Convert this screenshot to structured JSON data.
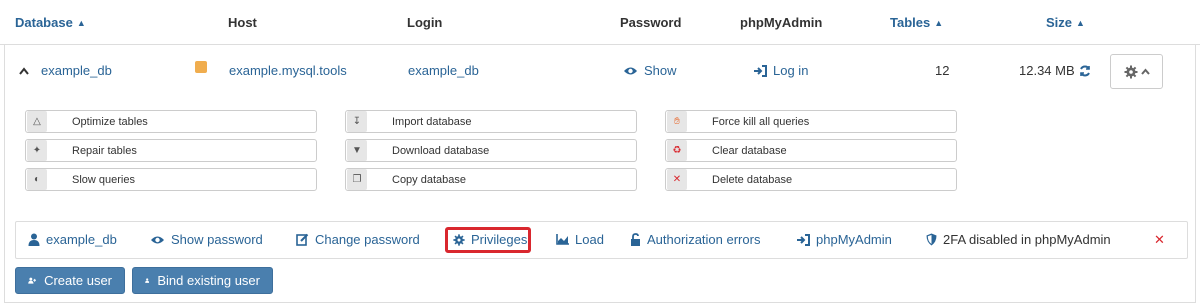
{
  "header": {
    "database": "Database",
    "host": "Host",
    "login": "Login",
    "password": "Password",
    "phpmyadmin": "phpMyAdmin",
    "tables": "Tables",
    "size": "Size"
  },
  "row": {
    "db_name": "example_db",
    "host": "example.mysql.tools",
    "login": "example_db",
    "password_link": "Show",
    "phpmyadmin_link": "Log in",
    "tables": "12",
    "size": "12.34 MB"
  },
  "actions": {
    "col1": [
      "Optimize tables",
      "Repair tables",
      "Slow queries"
    ],
    "col2": [
      "Import database",
      "Download database",
      "Copy database"
    ],
    "col3": [
      "Force kill all queries",
      "Clear database",
      "Delete database"
    ]
  },
  "user_bar": {
    "user": "example_db",
    "show_password": "Show password",
    "change_password": "Change password",
    "privileges": "Privileges",
    "load": "Load",
    "auth_errors": "Authorization errors",
    "phpmyadmin": "phpMyAdmin",
    "twofa": "2FA disabled in phpMyAdmin"
  },
  "buttons": {
    "create_user": "Create user",
    "bind_user": "Bind existing user"
  },
  "colors": {
    "link": "#2a6496",
    "button_blue": "#4a7fae",
    "highlight_red": "#d9272e",
    "note_orange": "#f0ad4e"
  }
}
